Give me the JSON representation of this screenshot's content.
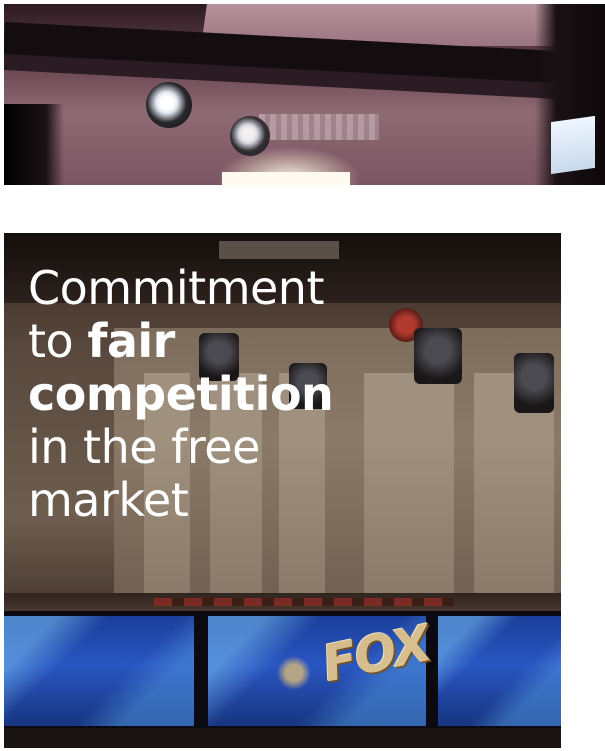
{
  "headline": {
    "line1": "Commitment",
    "line2_regular": "to ",
    "line2_bold": "fair",
    "line3_bold": "competition",
    "line4": "in the free",
    "line5": "market"
  },
  "colors": {
    "text": "#ffffff",
    "background": "#ffffff"
  }
}
